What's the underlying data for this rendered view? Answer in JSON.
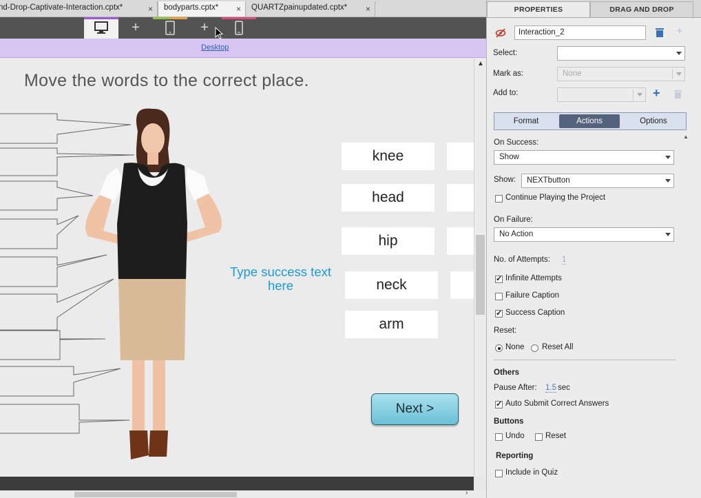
{
  "tabs": [
    {
      "label": "nd-Drop-Captivate-Interaction.cptx*",
      "close": "×"
    },
    {
      "label": "bodyparts.cptx*",
      "close": "×"
    },
    {
      "label": "QUARTZpainupdated.cptx*",
      "close": "×"
    }
  ],
  "breakpoint": {
    "label": "Desktop",
    "add_symbol": "+"
  },
  "slide": {
    "instruction": "Move the words to the correct place.",
    "words": [
      "knee",
      "head",
      "hip",
      "neck",
      "arm"
    ],
    "success_text": "Type success text here",
    "next_button": "Next >"
  },
  "panel": {
    "tabs": [
      "PROPERTIES",
      "DRAG AND DROP"
    ],
    "interaction_name": "Interaction_2",
    "select_label": "Select:",
    "select_value": "",
    "mark_as_label": "Mark as:",
    "mark_as_value": "None",
    "add_to_label": "Add to:",
    "add_to_value": "",
    "subtabs": [
      "Format",
      "Actions",
      "Options"
    ],
    "on_success_label": "On Success:",
    "on_success_value": "Show",
    "show_label": "Show:",
    "show_value": "NEXTbutton",
    "continue_label": "Continue Playing the Project",
    "on_failure_label": "On Failure:",
    "on_failure_value": "No Action",
    "attempts_label": "No. of Attempts:",
    "attempts_value": "1",
    "infinite_label": "Infinite Attempts",
    "failure_caption_label": "Failure Caption",
    "success_caption_label": "Success Caption",
    "reset_label": "Reset:",
    "reset_none": "None",
    "reset_all": "Reset All",
    "others_heading": "Others",
    "pause_after_label": "Pause After:",
    "pause_after_value": "1.5",
    "pause_after_unit": "sec",
    "auto_submit_label": "Auto Submit Correct Answers",
    "buttons_heading": "Buttons",
    "undo_label": "Undo",
    "reset_btn_label": "Reset",
    "reporting_heading": "Reporting",
    "include_quiz_label": "Include in Quiz"
  },
  "colors": {
    "breakpoint_bar": "#d9c5f4",
    "success_text": "#1a9ad9",
    "active_subtab": "#55627c",
    "device_bar": "#535353"
  }
}
